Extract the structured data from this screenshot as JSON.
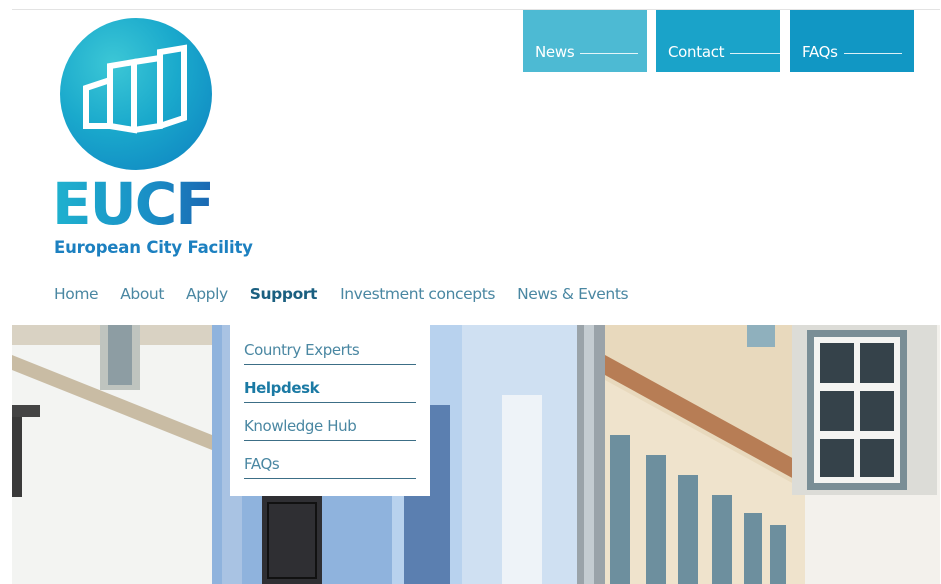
{
  "utility_nav": [
    {
      "label": "News"
    },
    {
      "label": "Contact"
    },
    {
      "label": "FAQs"
    }
  ],
  "logo": {
    "abbreviation": "EUCF",
    "name": "European City Facility"
  },
  "main_nav": {
    "items": [
      {
        "label": "Home"
      },
      {
        "label": "About"
      },
      {
        "label": "Apply"
      },
      {
        "label": "Support"
      },
      {
        "label": "Investment concepts"
      },
      {
        "label": "News & Events"
      }
    ],
    "active": "Support"
  },
  "support_dropdown": {
    "items": [
      {
        "label": "Country Experts"
      },
      {
        "label": "Helpdesk"
      },
      {
        "label": "Knowledge Hub"
      },
      {
        "label": "FAQs"
      }
    ],
    "active": "Helpdesk"
  },
  "colors": {
    "accent_light": "#4dbad3",
    "accent": "#1aa3c9",
    "accent_dark": "#1197c4",
    "nav_text": "#4a87a2",
    "nav_active": "#1a5f80",
    "logo_blue": "#1c80c0"
  },
  "hero": {
    "image": "street-facade-photo"
  }
}
